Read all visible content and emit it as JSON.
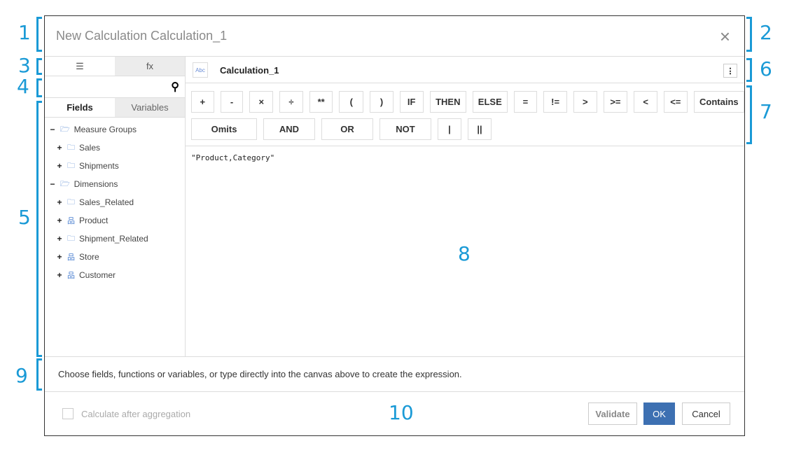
{
  "dialog": {
    "title": "New Calculation Calculation_1",
    "close": "×"
  },
  "left": {
    "tab_list": "☰",
    "tab_fx": "fx",
    "search_placeholder": "",
    "search_icon": "search-icon",
    "fields_tab": "Fields",
    "variables_tab": "Variables",
    "tree": [
      {
        "toggle": "−",
        "label": "Measure Groups",
        "icon": "folder-open"
      },
      {
        "toggle": "+",
        "label": "Sales",
        "icon": "folder"
      },
      {
        "toggle": "+",
        "label": "Shipments",
        "icon": "folder"
      },
      {
        "toggle": "−",
        "label": "Dimensions",
        "icon": "folder-open"
      },
      {
        "toggle": "+",
        "label": "Sales_Related",
        "icon": "folder"
      },
      {
        "toggle": "+",
        "label": "Product",
        "icon": "hierarchy"
      },
      {
        "toggle": "+",
        "label": "Shipment_Related",
        "icon": "folder"
      },
      {
        "toggle": "+",
        "label": "Store",
        "icon": "hierarchy"
      },
      {
        "toggle": "+",
        "label": "Customer",
        "icon": "hierarchy"
      }
    ]
  },
  "editor": {
    "type_badge": "Abc",
    "name": "Calculation_1",
    "more": "⋮",
    "ops_row1": [
      "+",
      "-",
      "×",
      "÷",
      "**",
      "(",
      ")",
      "IF",
      "THEN",
      "ELSE",
      "=",
      "!=",
      ">",
      ">=",
      "<",
      "<=",
      "Contains"
    ],
    "ops_row2": [
      "Omits",
      "AND",
      "OR",
      "NOT",
      "|",
      "||"
    ],
    "expression": "\"Product,Category\""
  },
  "status": "Choose fields, functions or variables, or type directly into the canvas above to create the expression.",
  "footer": {
    "checkbox_label": "Calculate after aggregation",
    "checked": false,
    "validate": "Validate",
    "ok": "OK",
    "cancel": "Cancel"
  },
  "annotations": [
    "1",
    "2",
    "3",
    "4",
    "5",
    "6",
    "7",
    "8",
    "9",
    "10"
  ],
  "colors": {
    "accent": "#3d70b2",
    "annotation": "#1a9ad6"
  }
}
